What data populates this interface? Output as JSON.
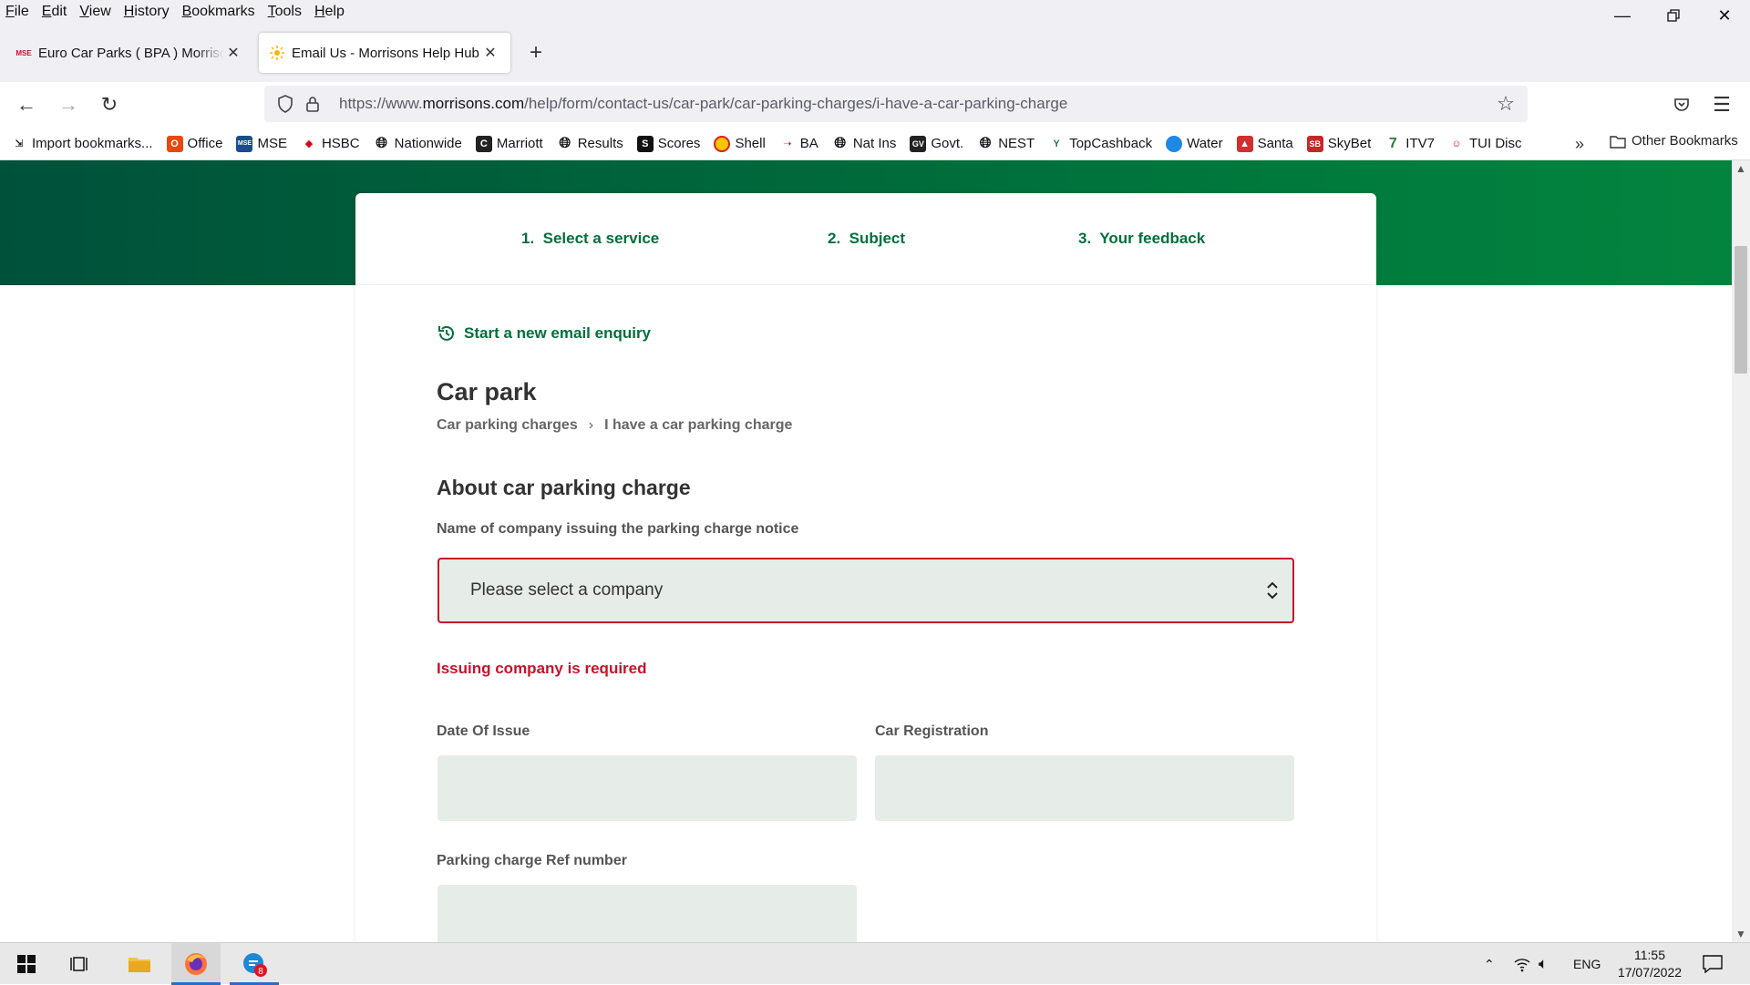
{
  "menubar": {
    "items": [
      "File",
      "Edit",
      "View",
      "History",
      "Bookmarks",
      "Tools",
      "Help"
    ]
  },
  "tabs": [
    {
      "title": "Euro Car Parks ( BPA ) Morrisons Car Park",
      "favicon": "mse-favicon",
      "favicon_text": "MSE"
    },
    {
      "title": "Email Us - Morrisons Help Hub",
      "favicon": "morrisons-favicon"
    }
  ],
  "url": {
    "prefix": "https://www.",
    "domain": "morrisons.com",
    "path": "/help/form/contact-us/car-park/car-parking-charges/i-have-a-car-parking-charge"
  },
  "bookmarks": [
    {
      "label": "Import bookmarks...",
      "icon": "import-icon"
    },
    {
      "label": "Office",
      "icon": "office-icon"
    },
    {
      "label": "MSE",
      "icon": "mse-icon"
    },
    {
      "label": "HSBC",
      "icon": "hsbc-icon"
    },
    {
      "label": "Nationwide",
      "icon": "globe-icon"
    },
    {
      "label": "Marriott",
      "icon": "marriott-icon"
    },
    {
      "label": "Results",
      "icon": "globe-icon"
    },
    {
      "label": "Scores",
      "icon": "scores-icon"
    },
    {
      "label": "Shell",
      "icon": "shell-icon"
    },
    {
      "label": "BA",
      "icon": "ba-icon"
    },
    {
      "label": "Nat Ins",
      "icon": "globe-icon"
    },
    {
      "label": "Govt.",
      "icon": "govt-icon"
    },
    {
      "label": "NEST",
      "icon": "globe-icon"
    },
    {
      "label": "TopCashback",
      "icon": "topcashback-icon"
    },
    {
      "label": "Water",
      "icon": "water-icon"
    },
    {
      "label": "Santa",
      "icon": "santa-icon"
    },
    {
      "label": "SkyBet",
      "icon": "skybet-icon"
    },
    {
      "label": "ITV7",
      "icon": "itv7-icon"
    },
    {
      "label": "TUI Disc",
      "icon": "tui-icon"
    }
  ],
  "other_bookmarks": "Other Bookmarks",
  "steps": [
    "1.  Select a service",
    "2.  Subject",
    "3.  Your feedback"
  ],
  "new_enquiry": "Start a new email enquiry",
  "page_title": "Car park",
  "breadcrumb": {
    "first": "Car parking charges",
    "second": "I have a car parking charge"
  },
  "section_title": "About car parking charge",
  "company_field": {
    "label": "Name of company issuing the parking charge notice",
    "placeholder": "Please select a company",
    "error": "Issuing company is required"
  },
  "date_field": {
    "label": "Date Of Issue",
    "value": ""
  },
  "registration_field": {
    "label": "Car Registration",
    "value": ""
  },
  "ref_field": {
    "label": "Parking charge Ref number",
    "value": ""
  },
  "taskbar": {
    "lang": "ENG",
    "time": "11:55",
    "date": "17/07/2022",
    "badge": "8"
  },
  "colors": {
    "brand_green": "#00703c",
    "error_red": "#c4142b",
    "field_bg": "#e6ece8"
  }
}
